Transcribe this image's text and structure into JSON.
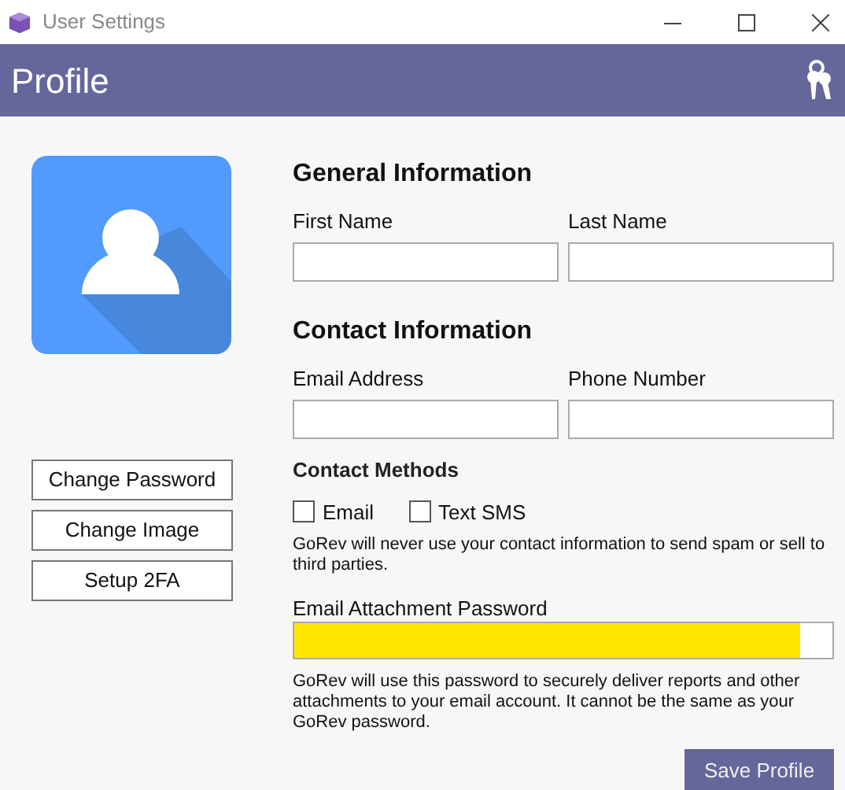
{
  "window": {
    "title": "User Settings"
  },
  "header": {
    "title": "Profile"
  },
  "profile_actions": [
    "Change Password",
    "Change Image",
    "Setup 2FA"
  ],
  "general_information": {
    "heading": "General Information",
    "fields": [
      {
        "label": "First Name"
      },
      {
        "label": "Last Name"
      }
    ]
  },
  "contact_information": {
    "heading": "Contact Information",
    "fields": [
      {
        "label": "Email Address"
      },
      {
        "label": "Phone Number"
      }
    ],
    "methods_heading": "Contact Methods",
    "methods": [
      {
        "label": "Email",
        "checked": false
      },
      {
        "label": "Text SMS",
        "checked": false
      }
    ],
    "notice": "GoRev will never use your contact information to send spam or sell to third parties."
  },
  "email_attachment_password": {
    "label": "Email Attachment Password",
    "highlighted": true,
    "note": "GoRev will use this password to securely deliver reports and other attachments to your email account. It cannot be the same as your GoRev password."
  },
  "save_button": "Save Profile"
}
